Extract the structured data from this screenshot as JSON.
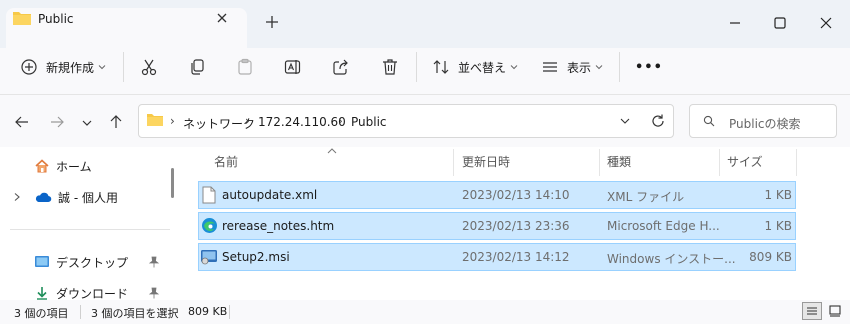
{
  "window": {
    "tab_title": "Public",
    "new_tab": "+",
    "minimize": "—",
    "maximize": "☐",
    "close": "✕"
  },
  "toolbar": {
    "new_label": "新規作成",
    "sort_label": "並べ替え",
    "view_label": "表示",
    "more_label": "•••"
  },
  "address": {
    "breadcrumbs": [
      "ネットワーク",
      "172.24.110.60",
      "Public"
    ],
    "search_placeholder": "Publicの検索"
  },
  "sidebar": {
    "items": [
      {
        "label": "ホーム",
        "icon": "home-icon"
      },
      {
        "label": "誠 - 個人用",
        "icon": "cloud-icon"
      },
      {
        "label": "デスクトップ",
        "icon": "desktop-icon"
      },
      {
        "label": "ダウンロード",
        "icon": "download-icon"
      }
    ]
  },
  "file_list": {
    "columns": [
      "名前",
      "更新日時",
      "種類",
      "サイズ"
    ],
    "rows": [
      {
        "name": "autoupdate.xml",
        "modified": "2023/02/13 14:10",
        "type": "XML ファイル",
        "size": "1 KB",
        "icon": "xml-file-icon",
        "selected": true
      },
      {
        "name": "rerease_notes.htm",
        "modified": "2023/02/13 23:36",
        "type": "Microsoft Edge H...",
        "size": "1 KB",
        "icon": "edge-html-icon",
        "selected": true
      },
      {
        "name": "Setup2.msi",
        "modified": "2023/02/13 14:12",
        "type": "Windows インストー...",
        "size": "809 KB",
        "icon": "msi-installer-icon",
        "selected": true
      }
    ]
  },
  "status": {
    "item_count": "3 個の項目",
    "selected_count": "3 個の項目を選択",
    "selected_size": "809 KB"
  },
  "colors": {
    "selection_fill": "#cce8ff",
    "selection_border": "#99d1ff",
    "folder_yellow": "#f7c948",
    "accent_blue": "#0067c0"
  }
}
